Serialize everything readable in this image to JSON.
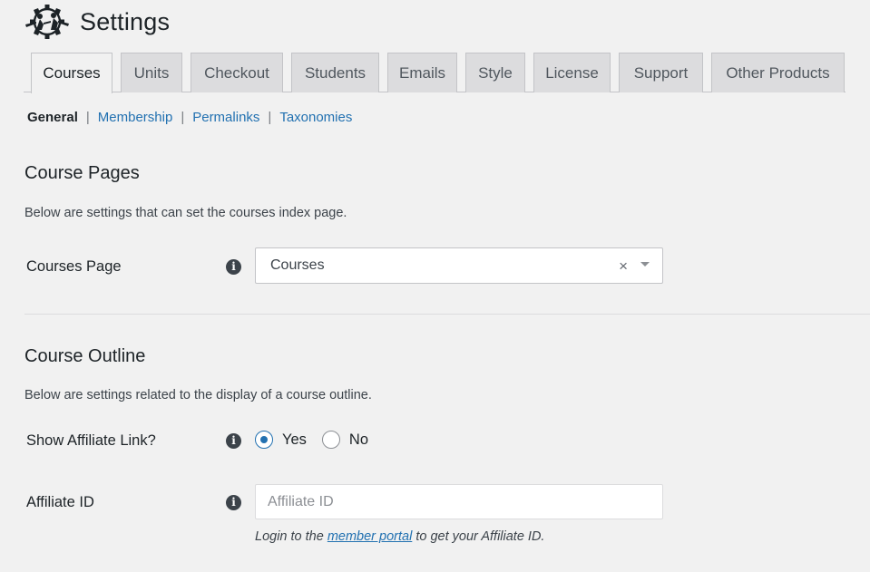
{
  "header": {
    "title": "Settings",
    "logo_icon": "ninja-logo"
  },
  "tabs": [
    {
      "label": "Courses",
      "active": true
    },
    {
      "label": "Units",
      "active": false
    },
    {
      "label": "Checkout",
      "active": false
    },
    {
      "label": "Students",
      "active": false
    },
    {
      "label": "Emails",
      "active": false
    },
    {
      "label": "Style",
      "active": false
    },
    {
      "label": "License",
      "active": false
    },
    {
      "label": "Support",
      "active": false
    },
    {
      "label": "Other Products",
      "active": false
    }
  ],
  "subnav": {
    "items": [
      {
        "label": "General",
        "current": true
      },
      {
        "label": "Membership",
        "current": false
      },
      {
        "label": "Permalinks",
        "current": false
      },
      {
        "label": "Taxonomies",
        "current": false
      }
    ],
    "separator": "|"
  },
  "course_pages": {
    "title": "Course Pages",
    "description": "Below are settings that can set the courses index page.",
    "courses_page": {
      "label": "Courses Page",
      "value": "Courses",
      "clear_glyph": "×"
    }
  },
  "course_outline": {
    "title": "Course Outline",
    "description": "Below are settings related to the display of a course outline.",
    "show_affiliate_link": {
      "label": "Show Affiliate Link?",
      "options": [
        {
          "label": "Yes",
          "checked": true
        },
        {
          "label": "No",
          "checked": false
        }
      ]
    },
    "affiliate_id": {
      "label": "Affiliate ID",
      "value": "",
      "placeholder": "Affiliate ID",
      "help_prefix": "Login to the",
      "help_link": "member portal",
      "help_suffix": "to get your Affiliate ID."
    }
  },
  "info_glyph": "i",
  "colors": {
    "link": "#2271b1",
    "background": "#f1f1f1",
    "tab_inactive": "#dcdcde"
  }
}
